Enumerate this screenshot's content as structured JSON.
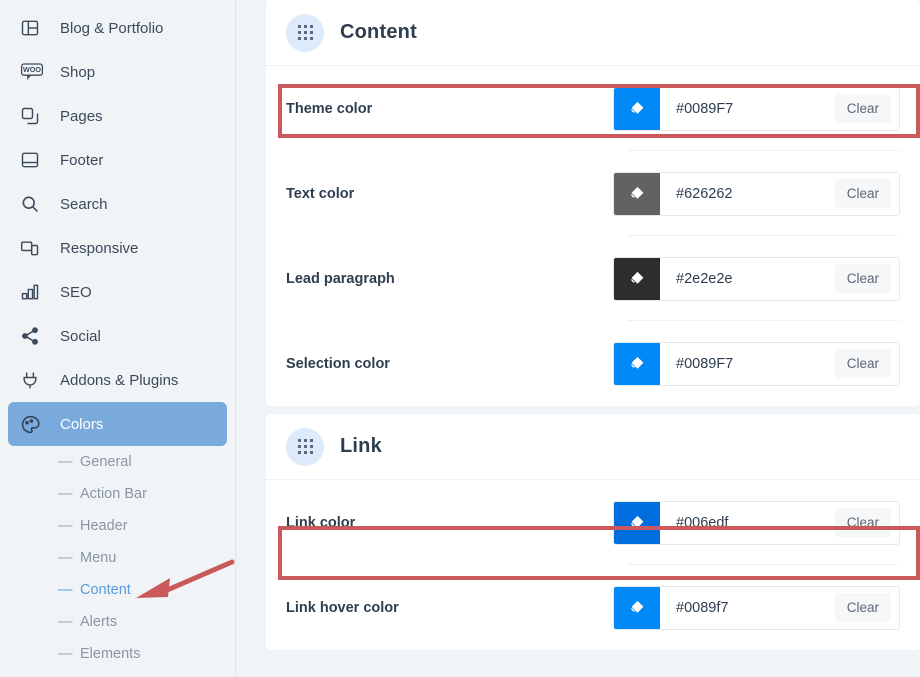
{
  "sidebar": {
    "items": [
      {
        "label": "Blog & Portfolio",
        "icon": "layout-icon",
        "active": false
      },
      {
        "label": "Shop",
        "icon": "woocommerce-icon",
        "active": false
      },
      {
        "label": "Pages",
        "icon": "pages-copy-icon",
        "active": false
      },
      {
        "label": "Footer",
        "icon": "footer-icon",
        "active": false
      },
      {
        "label": "Search",
        "icon": "search-icon",
        "active": false
      },
      {
        "label": "Responsive",
        "icon": "responsive-devices-icon",
        "active": false
      },
      {
        "label": "SEO",
        "icon": "bar-chart-icon",
        "active": false
      },
      {
        "label": "Social",
        "icon": "share-icon",
        "active": false
      },
      {
        "label": "Addons & Plugins",
        "icon": "plug-icon",
        "active": false
      },
      {
        "label": "Colors",
        "icon": "palette-icon",
        "active": true
      }
    ],
    "sub_items": [
      {
        "label": "General",
        "active": false
      },
      {
        "label": "Action Bar",
        "active": false
      },
      {
        "label": "Header",
        "active": false
      },
      {
        "label": "Menu",
        "active": false
      },
      {
        "label": "Content",
        "active": true
      },
      {
        "label": "Alerts",
        "active": false
      },
      {
        "label": "Elements",
        "active": false
      }
    ],
    "active_color": "#79aadb",
    "active_sub_color": "#5b9bd8"
  },
  "main": {
    "sections": [
      {
        "title": "Content",
        "icon": "drag-grid-icon",
        "rows": [
          {
            "label": "Theme color",
            "value": "#0089F7",
            "swatch": "#0089F7",
            "clear_label": "Clear",
            "highlighted": true
          },
          {
            "label": "Text color",
            "value": "#626262",
            "swatch": "#626262",
            "clear_label": "Clear",
            "highlighted": false
          },
          {
            "label": "Lead paragraph",
            "value": "#2e2e2e",
            "swatch": "#2e2e2e",
            "clear_label": "Clear",
            "highlighted": false
          },
          {
            "label": "Selection color",
            "value": "#0089F7",
            "swatch": "#0089F7",
            "clear_label": "Clear",
            "highlighted": false
          }
        ]
      },
      {
        "title": "Link",
        "icon": "drag-grid-icon",
        "rows": [
          {
            "label": "Link color",
            "value": "#006edf",
            "swatch": "#006edf",
            "clear_label": "Clear",
            "highlighted": true
          },
          {
            "label": "Link hover color",
            "value": "#0089f7",
            "swatch": "#0089f7",
            "clear_label": "Clear",
            "highlighted": false
          }
        ]
      }
    ]
  },
  "annotations": {
    "highlight_color": "#c9595b",
    "arrow_target": "Content"
  }
}
